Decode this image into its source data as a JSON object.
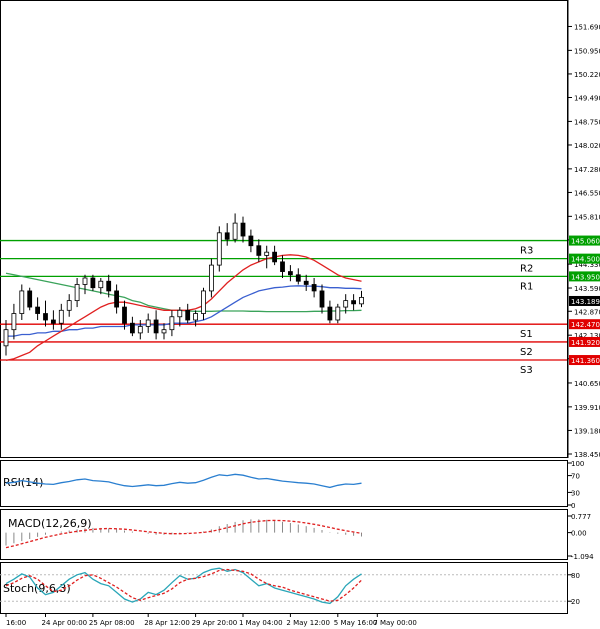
{
  "chart_data": {
    "type": "candlestick",
    "main": {
      "y_range": [
        138.45,
        152.2
      ],
      "y_ticks": [
        "151.690",
        "150.950",
        "150.220",
        "149.490",
        "148.750",
        "148.020",
        "147.280",
        "146.550",
        "145.810",
        "145.080",
        "144.330",
        "143.590",
        "142.870",
        "142.130",
        "141.400",
        "140.650",
        "139.910",
        "139.180",
        "138.450"
      ],
      "current_price": {
        "value": 143.189,
        "label": "143.189"
      },
      "levels": [
        {
          "name": "R3",
          "value": 145.06,
          "label": "145.060",
          "color": "#00a000"
        },
        {
          "name": "R2",
          "value": 144.5,
          "label": "144.500",
          "color": "#00a000"
        },
        {
          "name": "R1",
          "value": 143.95,
          "label": "143.950",
          "color": "#00a000"
        },
        {
          "name": "S1",
          "value": 142.47,
          "label": "142.470",
          "color": "#e00000"
        },
        {
          "name": "S2",
          "value": 141.92,
          "label": "141.920",
          "color": "#e00000"
        },
        {
          "name": "S3",
          "value": 141.36,
          "label": "141.360",
          "color": "#e00000"
        }
      ],
      "candles": [
        [
          141.8,
          142.6,
          141.5,
          142.3
        ],
        [
          142.3,
          143.1,
          142.0,
          142.8
        ],
        [
          142.8,
          143.7,
          142.6,
          143.5
        ],
        [
          143.5,
          143.6,
          142.9,
          143.0
        ],
        [
          143.0,
          143.3,
          142.6,
          142.8
        ],
        [
          142.8,
          143.2,
          142.4,
          142.6
        ],
        [
          142.6,
          142.9,
          142.3,
          142.5
        ],
        [
          142.5,
          143.1,
          142.3,
          142.9
        ],
        [
          142.9,
          143.4,
          142.7,
          143.2
        ],
        [
          143.2,
          143.9,
          143.0,
          143.7
        ],
        [
          143.7,
          144.0,
          143.4,
          143.9
        ],
        [
          143.9,
          144.0,
          143.5,
          143.6
        ],
        [
          143.6,
          143.9,
          143.4,
          143.8
        ],
        [
          143.8,
          144.0,
          143.3,
          143.5
        ],
        [
          143.5,
          143.7,
          142.8,
          143.0
        ],
        [
          143.0,
          143.2,
          142.3,
          142.5
        ],
        [
          142.5,
          142.7,
          142.1,
          142.2
        ],
        [
          142.2,
          142.6,
          142.0,
          142.4
        ],
        [
          142.4,
          142.8,
          142.2,
          142.6
        ],
        [
          142.6,
          142.9,
          142.0,
          142.2
        ],
        [
          142.2,
          142.5,
          142.0,
          142.3
        ],
        [
          142.3,
          142.9,
          142.1,
          142.7
        ],
        [
          142.7,
          143.0,
          142.4,
          142.9
        ],
        [
          142.9,
          143.1,
          142.5,
          142.6
        ],
        [
          142.6,
          142.9,
          142.4,
          142.8
        ],
        [
          142.8,
          143.6,
          142.6,
          143.5
        ],
        [
          143.5,
          144.5,
          143.3,
          144.3
        ],
        [
          144.3,
          145.5,
          144.1,
          145.3
        ],
        [
          145.3,
          145.6,
          144.9,
          145.1
        ],
        [
          145.1,
          145.9,
          145.0,
          145.6
        ],
        [
          145.6,
          145.8,
          145.0,
          145.2
        ],
        [
          145.2,
          145.4,
          144.7,
          144.9
        ],
        [
          144.9,
          145.1,
          144.4,
          144.6
        ],
        [
          144.6,
          144.9,
          144.2,
          144.7
        ],
        [
          144.7,
          144.9,
          144.3,
          144.4
        ],
        [
          144.4,
          144.6,
          143.9,
          144.1
        ],
        [
          144.1,
          144.3,
          143.8,
          144.0
        ],
        [
          144.0,
          144.2,
          143.7,
          143.8
        ],
        [
          143.8,
          144.0,
          143.5,
          143.7
        ],
        [
          143.7,
          143.9,
          143.3,
          143.5
        ],
        [
          143.5,
          143.7,
          142.8,
          143.0
        ],
        [
          143.0,
          143.2,
          142.5,
          142.6
        ],
        [
          142.6,
          143.1,
          142.5,
          143.0
        ],
        [
          143.0,
          143.4,
          142.8,
          143.2
        ],
        [
          143.2,
          143.4,
          142.9,
          143.1
        ],
        [
          143.1,
          143.5,
          143.0,
          143.3
        ]
      ],
      "ma_red": [
        141.35,
        141.4,
        141.5,
        141.6,
        141.8,
        141.95,
        142.1,
        142.25,
        142.4,
        142.55,
        142.7,
        142.85,
        143.0,
        143.1,
        143.15,
        143.15,
        143.1,
        143.05,
        143.0,
        142.95,
        142.9,
        142.9,
        142.9,
        142.9,
        142.95,
        143.05,
        143.25,
        143.5,
        143.75,
        143.95,
        144.15,
        144.3,
        144.4,
        144.5,
        144.55,
        144.6,
        144.62,
        144.6,
        144.55,
        144.45,
        144.3,
        144.15,
        144.0,
        143.9,
        143.85,
        143.8
      ],
      "ma_blue": [
        142.1,
        142.1,
        142.15,
        142.15,
        142.2,
        142.2,
        142.25,
        142.25,
        142.3,
        142.3,
        142.35,
        142.35,
        142.4,
        142.4,
        142.4,
        142.4,
        142.45,
        142.45,
        142.45,
        142.45,
        142.45,
        142.5,
        142.5,
        142.5,
        142.55,
        142.6,
        142.7,
        142.85,
        143.0,
        143.15,
        143.3,
        143.4,
        143.5,
        143.55,
        143.6,
        143.62,
        143.65,
        143.66,
        143.65,
        143.65,
        143.63,
        143.6,
        143.6,
        143.58,
        143.58,
        143.57
      ],
      "ma_green": [
        144.05,
        144.0,
        143.95,
        143.9,
        143.85,
        143.8,
        143.75,
        143.7,
        143.65,
        143.6,
        143.55,
        143.5,
        143.45,
        143.4,
        143.35,
        143.3,
        143.2,
        143.15,
        143.05,
        143.0,
        142.95,
        142.9,
        142.9,
        142.88,
        142.87,
        142.87,
        142.87,
        142.88,
        142.88,
        142.88,
        142.88,
        142.87,
        142.87,
        142.86,
        142.86,
        142.86,
        142.86,
        142.86,
        142.86,
        142.87,
        142.87,
        142.88,
        142.88,
        142.89,
        142.89,
        142.9
      ]
    },
    "rsi": {
      "label": "RSI(14)",
      "ticks": [
        "100",
        "70",
        "30",
        "0"
      ],
      "tick_values": [
        100,
        70,
        30,
        0
      ],
      "values": [
        52,
        54,
        58,
        55,
        52,
        50,
        49,
        53,
        56,
        60,
        62,
        58,
        57,
        55,
        50,
        46,
        44,
        46,
        48,
        46,
        47,
        51,
        54,
        52,
        53,
        59,
        66,
        72,
        70,
        73,
        71,
        66,
        62,
        63,
        60,
        57,
        55,
        53,
        52,
        50,
        46,
        42,
        47,
        50,
        49,
        52
      ]
    },
    "macd": {
      "label": "MACD(12,26,9)",
      "ticks": [
        "0.777",
        "0.00",
        "-1.094"
      ],
      "tick_values": [
        0.777,
        0,
        -1.094
      ],
      "histogram": [
        -0.6,
        -0.5,
        -0.4,
        -0.3,
        -0.2,
        -0.1,
        0.0,
        0.05,
        0.1,
        0.15,
        0.2,
        0.22,
        0.22,
        0.2,
        0.15,
        0.1,
        0.05,
        0.0,
        -0.05,
        -0.1,
        -0.1,
        -0.08,
        -0.05,
        -0.02,
        0.0,
        0.05,
        0.15,
        0.3,
        0.4,
        0.5,
        0.58,
        0.62,
        0.62,
        0.6,
        0.55,
        0.5,
        0.45,
        0.38,
        0.3,
        0.22,
        0.12,
        0.02,
        -0.05,
        -0.1,
        -0.15,
        -0.18
      ],
      "signal": [
        -0.7,
        -0.62,
        -0.52,
        -0.42,
        -0.32,
        -0.22,
        -0.14,
        -0.06,
        0.0,
        0.06,
        0.11,
        0.15,
        0.18,
        0.19,
        0.18,
        0.16,
        0.12,
        0.08,
        0.04,
        0.0,
        -0.03,
        -0.05,
        -0.05,
        -0.04,
        -0.02,
        0.01,
        0.06,
        0.14,
        0.23,
        0.32,
        0.41,
        0.48,
        0.53,
        0.56,
        0.57,
        0.56,
        0.54,
        0.5,
        0.45,
        0.39,
        0.32,
        0.24,
        0.16,
        0.09,
        0.03,
        -0.03
      ]
    },
    "stoch": {
      "label": "Stoch(9,6,3)",
      "ticks": [
        "80",
        "20"
      ],
      "tick_values": [
        80,
        20
      ],
      "y_range": [
        0,
        100
      ],
      "k": [
        60,
        70,
        82,
        75,
        50,
        35,
        40,
        55,
        70,
        80,
        85,
        70,
        60,
        55,
        40,
        25,
        18,
        25,
        40,
        35,
        45,
        62,
        78,
        70,
        72,
        85,
        92,
        95,
        88,
        92,
        85,
        70,
        55,
        60,
        50,
        45,
        40,
        35,
        30,
        25,
        18,
        15,
        30,
        55,
        70,
        82
      ],
      "d": [
        55,
        62,
        72,
        78,
        70,
        55,
        42,
        45,
        55,
        68,
        78,
        80,
        72,
        62,
        52,
        40,
        28,
        22,
        28,
        33,
        38,
        48,
        62,
        70,
        72,
        76,
        82,
        90,
        92,
        90,
        88,
        82,
        70,
        60,
        55,
        52,
        45,
        40,
        35,
        30,
        25,
        20,
        22,
        35,
        50,
        68
      ]
    },
    "x_labels": [
      "16:00",
      "24 Apr 00:00",
      "25 Apr 08:00",
      "28 Apr 12:00",
      "29 Apr 20:00",
      "1 May 04:00",
      "2 May 12:00",
      "5 May 16:00",
      "7 May 00:00"
    ],
    "x_label_candle_index": [
      0,
      5,
      11,
      18,
      24,
      30,
      36,
      42,
      47
    ]
  }
}
